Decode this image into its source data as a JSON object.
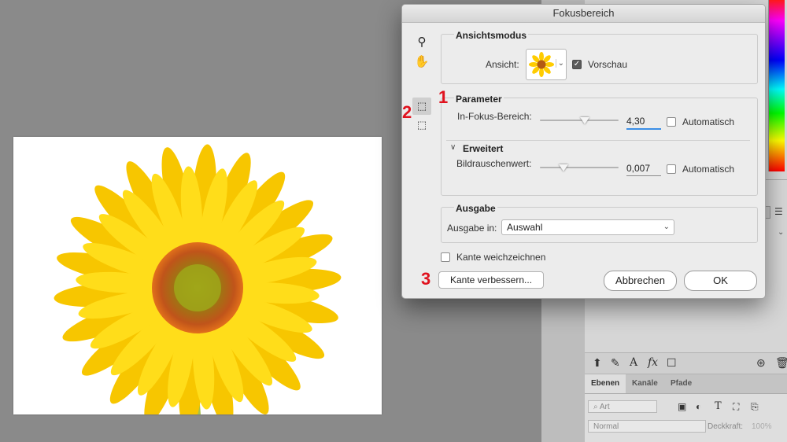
{
  "dialog": {
    "title": "Fokusbereich",
    "view_mode": {
      "title": "Ansichtsmodus",
      "view_label": "Ansicht:",
      "preview_label": "Vorschau",
      "preview_checked": true
    },
    "parameters": {
      "title": "Parameter",
      "in_focus_label": "In-Fokus-Bereich:",
      "in_focus_value": "4,30",
      "in_focus_auto_label": "Automatisch",
      "advanced_title": "Erweitert",
      "noise_label": "Bildrauschenwert:",
      "noise_value": "0,007",
      "noise_auto_label": "Automatisch"
    },
    "output": {
      "title": "Ausgabe",
      "output_label": "Ausgabe in:",
      "output_value": "Auswahl"
    },
    "soften_edge_label": "Kante weichzeichnen",
    "refine_edge_button": "Kante verbessern...",
    "cancel_button": "Abbrechen",
    "ok_button": "OK"
  },
  "annotations": [
    "1",
    "2",
    "3"
  ],
  "layers_panel": {
    "tabs": [
      "Ebenen",
      "Kanäle",
      "Pfade"
    ],
    "filter_placeholder": "Art",
    "blend_mode": "Normal",
    "opacity_label": "Deckkraft:",
    "opacity_value": "100%"
  },
  "colors": {
    "accent_annotation": "#e0121e",
    "focus_blue": "#3b8ee6",
    "sunflower_petal": "#ffd400",
    "sunflower_center": "#c0541a"
  }
}
